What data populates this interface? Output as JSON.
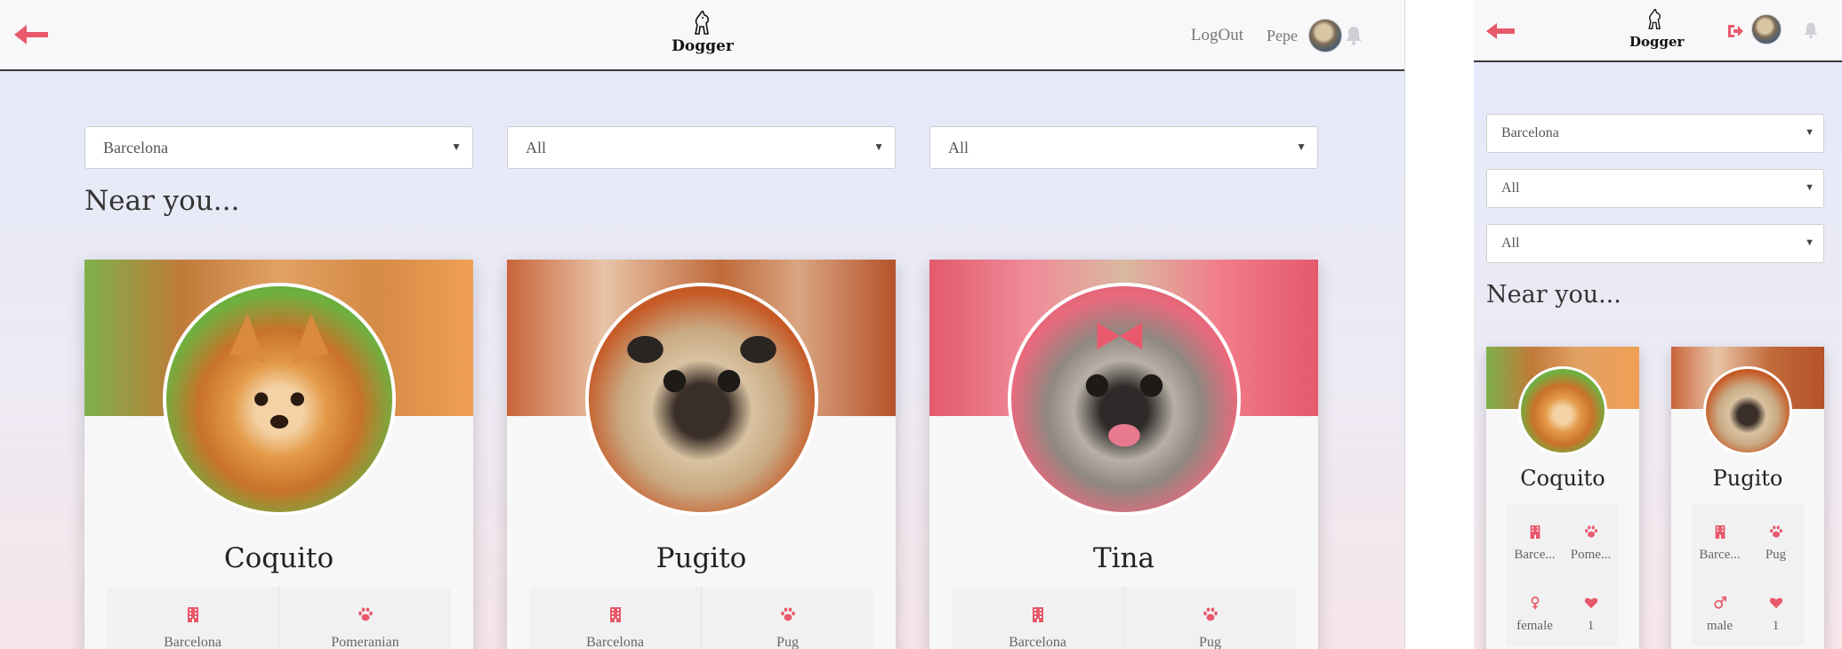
{
  "app": {
    "logo_text": "Dogger",
    "brand_color": "#e8596b"
  },
  "header": {
    "logout_label": "LogOut",
    "user_name": "Pepe"
  },
  "filters": {
    "city": "Barcelona",
    "breed": "All",
    "gender": "All"
  },
  "section_title": "Near you...",
  "dogs": [
    {
      "name": "Coquito",
      "city": "Barcelona",
      "breed": "Pomeranian",
      "city_short": "Barce...",
      "breed_short": "Pome...",
      "gender": "female",
      "likes": "1"
    },
    {
      "name": "Pugito",
      "city": "Barcelona",
      "breed": "Pug",
      "city_short": "Barce...",
      "breed_short": "Pug",
      "gender": "male",
      "likes": "1"
    },
    {
      "name": "Tina",
      "city": "Barcelona",
      "breed": "Pug"
    }
  ],
  "icons": {
    "back": "arrow-left-icon",
    "bell": "bell-icon",
    "city": "building-icon",
    "breed": "paw-icon",
    "logout": "sign-out-icon",
    "female": "female-icon",
    "male": "male-icon",
    "likes": "heart-icon"
  }
}
